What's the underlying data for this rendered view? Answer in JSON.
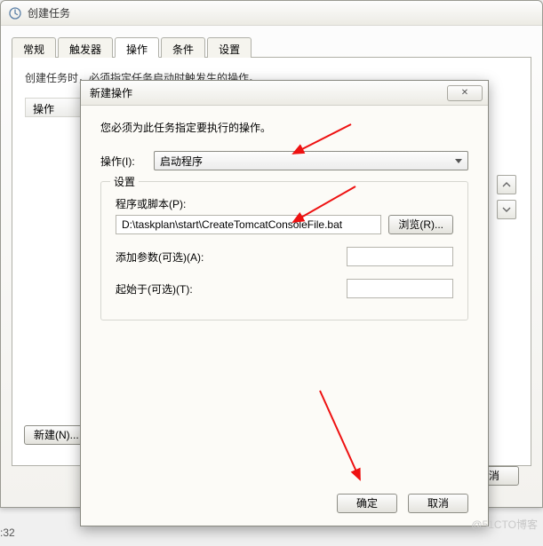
{
  "parent": {
    "title": "创建任务",
    "tabs": [
      "常规",
      "触发器",
      "操作",
      "条件",
      "设置"
    ],
    "active_tab_index": 2,
    "panel_hint": "创建任务时，必须指定任务启动时触发生的操作。",
    "list_header": "操作",
    "new_button": "新建(N)...",
    "cancel_button": "取消"
  },
  "modal": {
    "title": "新建操作",
    "close_glyph": "✕",
    "instruction": "您必须为此任务指定要执行的操作。",
    "action_label": "操作(I):",
    "action_value": "启动程序",
    "group_legend": "设置",
    "script_label": "程序或脚本(P):",
    "script_value": "D:\\taskplan\\start\\CreateTomcatConsoleFile.bat",
    "browse_button": "浏览(R)...",
    "args_label": "添加参数(可选)(A):",
    "args_value": "",
    "startin_label": "起始于(可选)(T):",
    "startin_value": "",
    "ok_button": "确定",
    "cancel_button": "取消"
  },
  "meta": {
    "watermark": "@51CTO博客",
    "time_fragment": ":32"
  }
}
